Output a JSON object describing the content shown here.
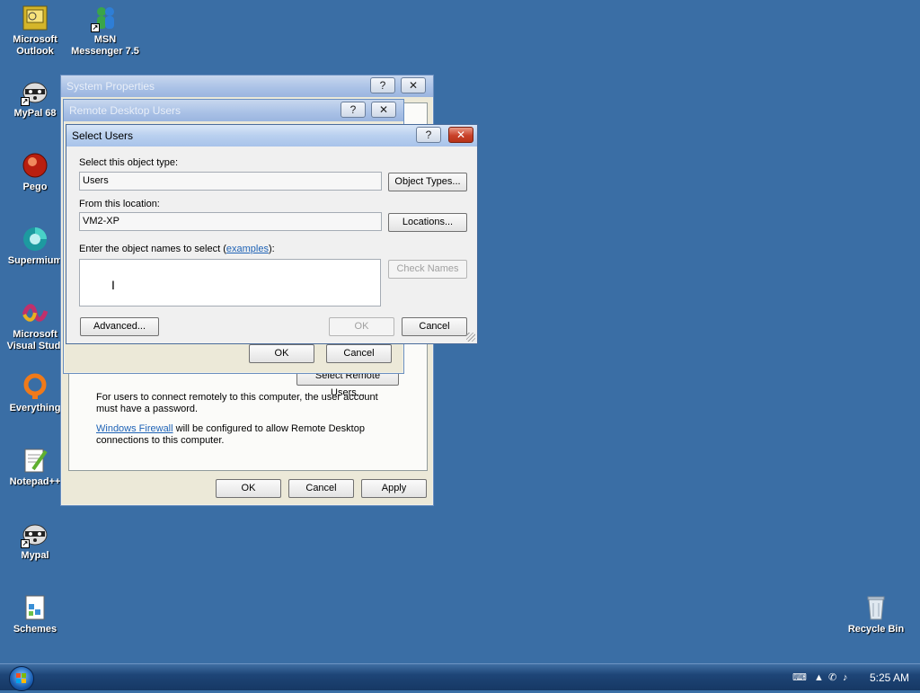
{
  "desktop": {
    "icons": [
      {
        "label": "Microsoft Outlook"
      },
      {
        "label": "MSN Messenger 7.5"
      },
      {
        "label": "MyPal 68"
      },
      {
        "label": "Pego"
      },
      {
        "label": "Supermium"
      },
      {
        "label": "Microsoft Visual Stud."
      },
      {
        "label": "Everything"
      },
      {
        "label": "Notepad++"
      },
      {
        "label": "Mypal"
      },
      {
        "label": "Schemes"
      },
      {
        "label": "Recycle Bin"
      }
    ]
  },
  "system_properties": {
    "title": "System Properties",
    "info_text": "For users to connect remotely to this computer, the user account must have a password.",
    "firewall_link": "Windows Firewall",
    "firewall_text": " will be configured to allow Remote Desktop connections to this computer.",
    "select_remote_users_label": "Select Remote Users...",
    "ok_label": "OK",
    "cancel_label": "Cancel",
    "apply_label": "Apply"
  },
  "remote_desktop_users": {
    "title": "Remote Desktop Users",
    "ok_label": "OK",
    "cancel_label": "Cancel"
  },
  "select_users": {
    "title": "Select Users",
    "object_type_label": "Select this object type:",
    "object_type_value": "Users",
    "object_types_button": "Object Types...",
    "location_label": "From this location:",
    "location_value": "VM2-XP",
    "locations_button": "Locations...",
    "names_label_prefix": "Enter the object names to select (",
    "names_label_link": "examples",
    "names_label_suffix": "):",
    "names_value": "",
    "check_names_button": "Check Names",
    "advanced_button": "Advanced...",
    "ok_label": "OK",
    "cancel_label": "Cancel"
  },
  "titlebar_buttons": {
    "help": "?",
    "close": "✕"
  },
  "taskbar": {
    "clock": "5:25 AM"
  }
}
